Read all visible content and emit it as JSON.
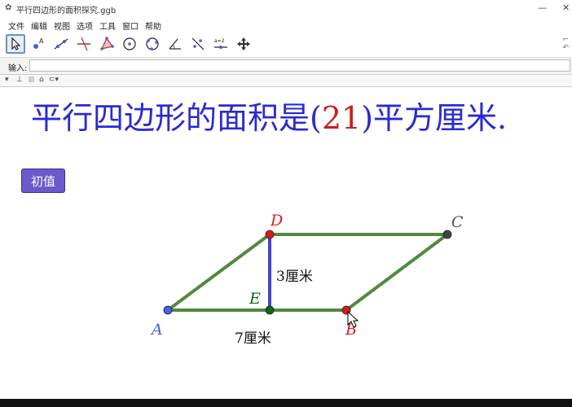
{
  "window": {
    "title": "平行四边形的面积探究.ggb",
    "app_icon": "geogebra-icon",
    "minimize": "—",
    "close": "✕"
  },
  "menu": [
    "文件",
    "编辑",
    "视图",
    "选项",
    "工具",
    "窗口",
    "帮助"
  ],
  "toolbar": {
    "tools": [
      "move-tool-icon",
      "point-tool-icon",
      "line-tool-icon",
      "perpendicular-tool-icon",
      "polygon-tool-icon",
      "circle-center-tool-icon",
      "circle-three-points-tool-icon",
      "angle-tool-icon",
      "reflect-tool-icon",
      "slider-tool-icon",
      "move-view-tool-icon"
    ],
    "slider_label": "a=2"
  },
  "input_bar": {
    "label": "输入:",
    "value": ""
  },
  "graphics": {
    "heading_prefix": "平行四边形的面积是(",
    "area_value": "21",
    "heading_suffix": ")平方厘米.",
    "reset_button": "初值",
    "points": {
      "A": "A",
      "B": "B",
      "C": "C",
      "D": "D",
      "E": "E"
    },
    "height_label": "3厘米",
    "base_label": "7厘米"
  },
  "colors": {
    "heading": "#2a2ad2",
    "value": "#cc1f1f",
    "edge": "#4f8a3e",
    "height": "#4444cc",
    "point_a": "#4b5de0",
    "point_red": "#e01818",
    "point_c": "#444444",
    "point_e": "#116611"
  }
}
